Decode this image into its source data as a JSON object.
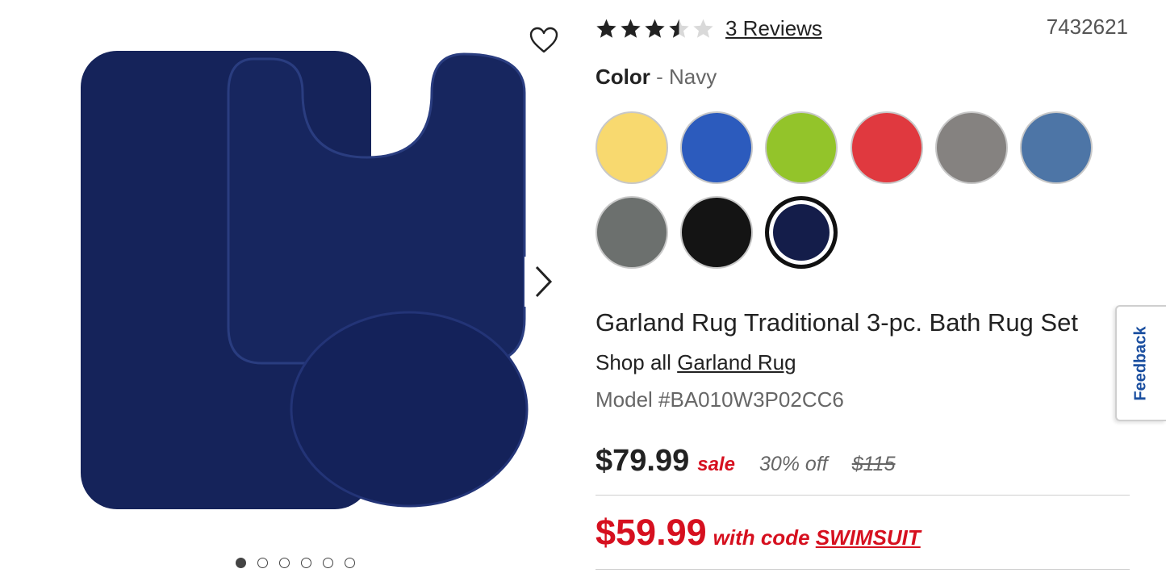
{
  "gallery": {
    "image_alt": "Navy 3-piece bath rug set",
    "image_count": 6,
    "active_index": 0,
    "wishlist_icon": "heart-outline-icon",
    "next_icon": "chevron-right-icon",
    "rug_color": "#15235a"
  },
  "rating": {
    "value": 3.5,
    "max": 5,
    "reviews_label": "3 Reviews"
  },
  "sku": "7432621",
  "color": {
    "label": "Color",
    "separator": " - ",
    "selected": "Navy",
    "swatches": [
      {
        "name": "Yellow",
        "hex": "#f8d96f"
      },
      {
        "name": "Blue",
        "hex": "#2c5bbd"
      },
      {
        "name": "Lime",
        "hex": "#93c42a"
      },
      {
        "name": "Red",
        "hex": "#e0393f"
      },
      {
        "name": "Gray",
        "hex": "#858280"
      },
      {
        "name": "Denim",
        "hex": "#4d75a6"
      },
      {
        "name": "Charcoal",
        "hex": "#6c706e"
      },
      {
        "name": "Black",
        "hex": "#141414"
      },
      {
        "name": "Navy",
        "hex": "#141d4a",
        "selected": true
      }
    ]
  },
  "product": {
    "title": "Garland Rug Traditional 3-pc. Bath Rug Set",
    "shop_all_prefix": "Shop all ",
    "brand": "Garland Rug",
    "model": "Model #BA010W3P02CC6"
  },
  "pricing": {
    "price": "$79.99",
    "sale_label": "sale",
    "discount": "30% off",
    "original": "$115",
    "promo_price": "$59.99",
    "promo_text": "with code ",
    "promo_code": "SWIMSUIT"
  },
  "feedback": {
    "label": "Feedback"
  },
  "colors": {
    "accent_red": "#d6101f",
    "feedback_blue": "#1b4fa0"
  }
}
